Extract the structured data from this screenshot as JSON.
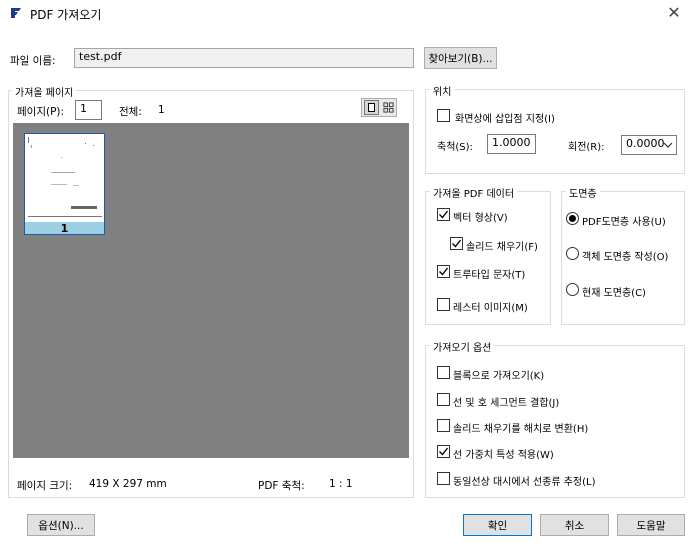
{
  "window": {
    "title": "PDF 가져오기",
    "close_glyph": "✕",
    "accent_color": "#0078d7"
  },
  "file": {
    "label": "파일 이름:",
    "value": "test.pdf",
    "browse_label": "찾아보기(B)..."
  },
  "pages": {
    "group_label": "가져올 페이지",
    "page_label": "페이지(P):",
    "page_value": "1",
    "total_label": "전체:",
    "total_value": "1",
    "view_toggle": [
      "single-page-view-icon",
      "grid-view-icon"
    ],
    "thumbnail_number": "1",
    "size_label": "페이지 크기:",
    "size_value": "419 X 297 mm",
    "scale_label": "PDF 축척:",
    "scale_value": "1 : 1"
  },
  "position": {
    "group_label": "위치",
    "specify_on_screen": {
      "label": "화면상에 삽입점 지정(I)",
      "checked": false
    },
    "scale_label": "축척(S):",
    "scale_value": "1.0000",
    "rotation_label": "회전(R):",
    "rotation_value": "0.0000"
  },
  "pdf_data": {
    "group_label": "가져올 PDF 데이터",
    "vector": {
      "label": "벡터 형상(V)",
      "checked": true
    },
    "solid_fill": {
      "label": "솔리드 채우기(F)",
      "checked": true
    },
    "truetype": {
      "label": "트루타입 문자(T)",
      "checked": true
    },
    "raster": {
      "label": "레스터 이미지(M)",
      "checked": false
    }
  },
  "layers": {
    "group_label": "도면층",
    "options": [
      {
        "label": "PDF도면층 사용(U)",
        "selected": true
      },
      {
        "label": "객체 도면층 작성(O)",
        "selected": false
      },
      {
        "label": "현재 도면층(C)",
        "selected": false
      }
    ]
  },
  "import_options": {
    "group_label": "가져오기 옵션",
    "items": [
      {
        "label": "블록으로 가져오기(K)",
        "checked": false
      },
      {
        "label": "선 및 호 세그먼트 결합(J)",
        "checked": false
      },
      {
        "label": "솔리드 채우기를 해치로 변환(H)",
        "checked": false
      },
      {
        "label": "선 가중치 특성 적용(W)",
        "checked": true
      },
      {
        "label": "동일선상 대시에서 선종류 추정(L)",
        "checked": false
      }
    ]
  },
  "footer": {
    "options_label": "옵션(N)...",
    "ok_label": "확인",
    "cancel_label": "취소",
    "help_label": "도움말"
  }
}
